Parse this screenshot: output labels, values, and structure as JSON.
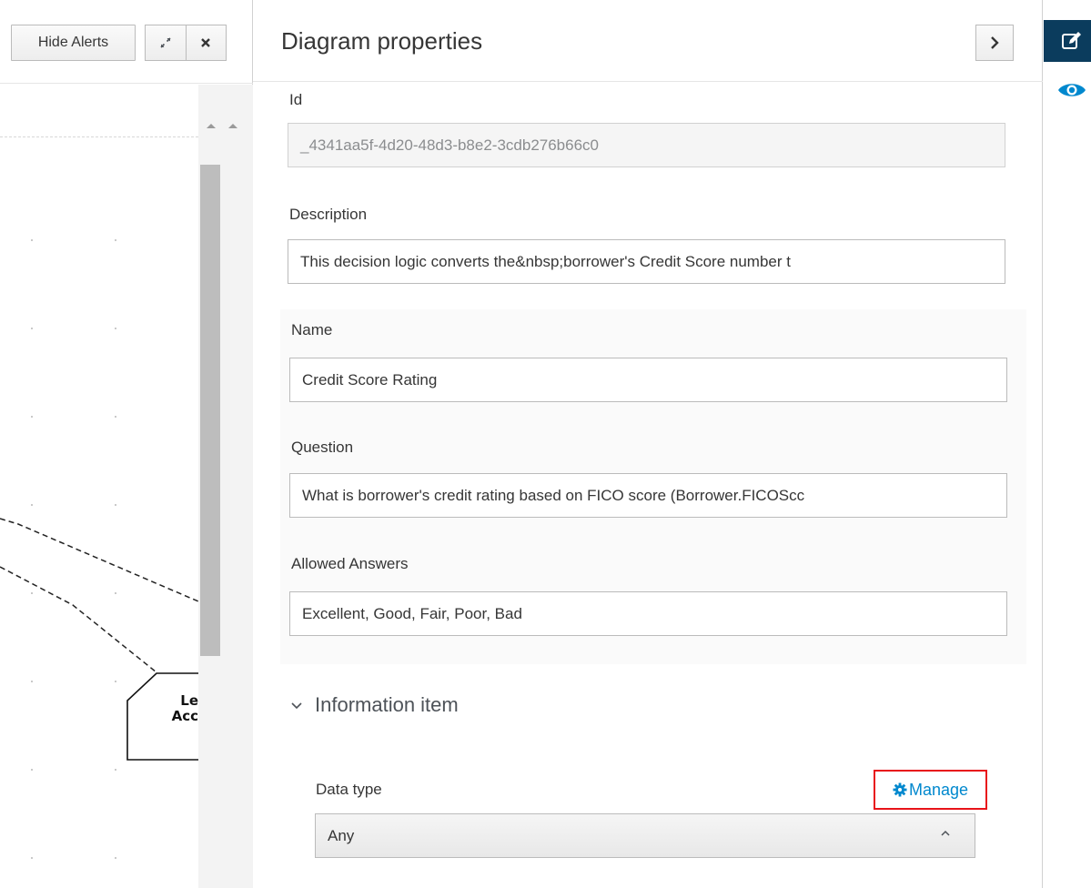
{
  "canvas": {
    "toolbar": {
      "hide_alerts_label": "Hide Alerts",
      "expand_icon": "expand-icon",
      "close_icon": "close-icon"
    },
    "node": {
      "label_line1": "Le",
      "label_line2": "Acc"
    }
  },
  "panel": {
    "title": "Diagram properties",
    "collapse_icon": "chevron-right-icon",
    "fields": {
      "id": {
        "label": "Id",
        "value": "_4341aa5f-4d20-48d3-b8e2-3cdb276b66c0"
      },
      "description": {
        "label": "Description",
        "value": "This decision logic converts the&nbsp;borrower's Credit Score number t"
      },
      "name": {
        "label": "Name",
        "value": "Credit Score Rating"
      },
      "question": {
        "label": "Question",
        "value": "What is borrower's credit rating based on FICO score (Borrower.FICOScc"
      },
      "allowed_answers": {
        "label": "Allowed Answers",
        "value": "Excellent, Good, Fair, Poor, Bad"
      }
    },
    "information_item": {
      "title": "Information item",
      "data_type_label": "Data type",
      "manage_label": "Manage",
      "data_type_value": "Any"
    }
  },
  "rail": {
    "edit_icon": "edit-icon",
    "preview_icon": "eye-icon"
  },
  "colors": {
    "link": "#0088ce",
    "highlight_border": "#e8131a",
    "rail_active": "#0b3c5d"
  }
}
